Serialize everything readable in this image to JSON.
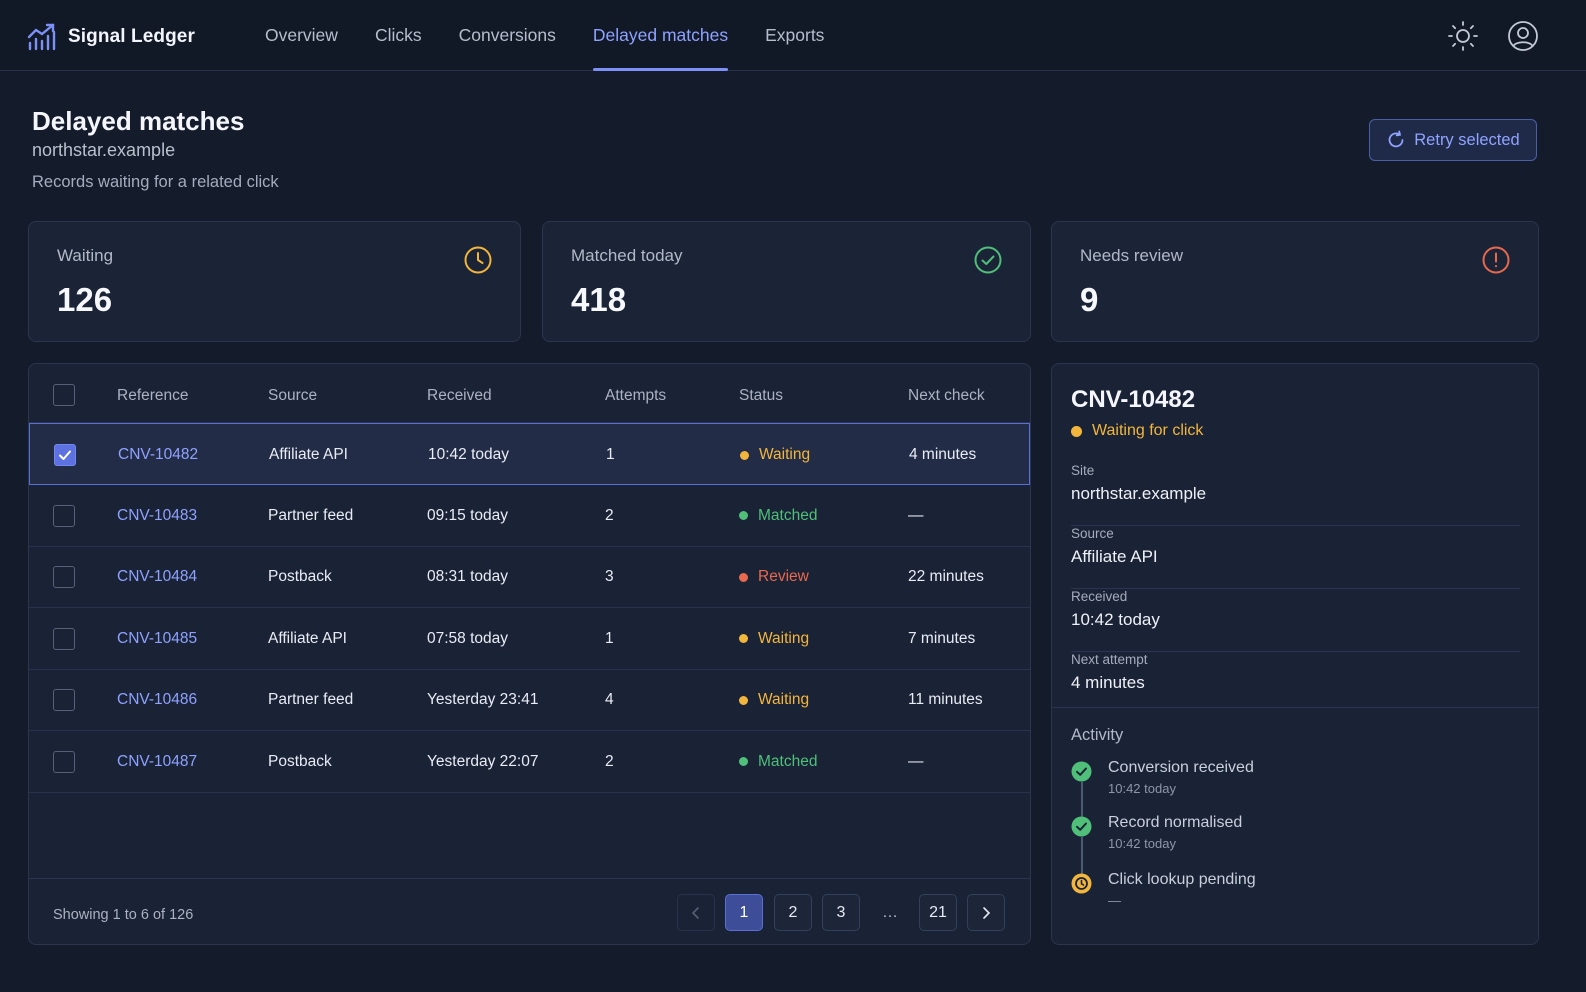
{
  "app": {
    "name": "Signal Ledger",
    "nav": [
      {
        "label": "Overview"
      },
      {
        "label": "Clicks"
      },
      {
        "label": "Conversions"
      },
      {
        "label": "Delayed matches"
      },
      {
        "label": "Exports"
      }
    ],
    "active_nav": "Delayed matches"
  },
  "header": {
    "title": "Delayed matches",
    "domain": "northstar.example",
    "description": "Records waiting for a related click",
    "retry_label": "Retry selected"
  },
  "stats": [
    {
      "label": "Waiting",
      "value": "126",
      "icon": "clock-icon",
      "color": "#f3b63c"
    },
    {
      "label": "Matched today",
      "value": "418",
      "icon": "check-circle-icon",
      "color": "#4fbf7a"
    },
    {
      "label": "Needs review",
      "value": "9",
      "icon": "alert-circle-icon",
      "color": "#e8694e"
    }
  ],
  "table": {
    "columns": [
      "Reference",
      "Source",
      "Received",
      "Attempts",
      "Status",
      "Next check"
    ],
    "rows": [
      {
        "ref": "CNV-10482",
        "source": "Affiliate API",
        "received": "10:42 today",
        "attempts": "1",
        "status": "Waiting",
        "status_color": "#f3b63c",
        "next": "4 minutes",
        "checked": true
      },
      {
        "ref": "CNV-10483",
        "source": "Partner feed",
        "received": "09:15 today",
        "attempts": "2",
        "status": "Matched",
        "status_color": "#4fbf7a",
        "next": "—",
        "checked": false
      },
      {
        "ref": "CNV-10484",
        "source": "Postback",
        "received": "08:31 today",
        "attempts": "3",
        "status": "Review",
        "status_color": "#e8694e",
        "next": "22 minutes",
        "checked": false
      },
      {
        "ref": "CNV-10485",
        "source": "Affiliate API",
        "received": "07:58 today",
        "attempts": "1",
        "status": "Waiting",
        "status_color": "#f3b63c",
        "next": "7 minutes",
        "checked": false
      },
      {
        "ref": "CNV-10486",
        "source": "Partner feed",
        "received": "Yesterday 23:41",
        "attempts": "4",
        "status": "Waiting",
        "status_color": "#f3b63c",
        "next": "11 minutes",
        "checked": false
      },
      {
        "ref": "CNV-10487",
        "source": "Postback",
        "received": "Yesterday 22:07",
        "attempts": "2",
        "status": "Matched",
        "status_color": "#4fbf7a",
        "next": "—",
        "checked": false
      }
    ],
    "showing": "Showing 1 to 6 of 126",
    "pages": [
      "1",
      "2",
      "3",
      "…",
      "21"
    ],
    "current_page": "1"
  },
  "detail": {
    "title": "CNV-10482",
    "status": "Waiting for click",
    "status_color": "#f3b63c",
    "fields": [
      {
        "label": "Site",
        "value": "northstar.example"
      },
      {
        "label": "Source",
        "value": "Affiliate API"
      },
      {
        "label": "Received",
        "value": "10:42 today"
      },
      {
        "label": "Next attempt",
        "value": "4 minutes"
      }
    ],
    "activity_title": "Activity",
    "activity": [
      {
        "text": "Conversion received",
        "time": "10:42 today",
        "state": "done"
      },
      {
        "text": "Record normalised",
        "time": "10:42 today",
        "state": "done"
      },
      {
        "text": "Click lookup pending",
        "time": "—",
        "state": "pending"
      }
    ]
  },
  "colors": {
    "accent": "#8ea2ff",
    "waiting": "#f3b63c",
    "matched": "#4fbf7a",
    "review": "#e8694e",
    "background": "#141b2b"
  }
}
